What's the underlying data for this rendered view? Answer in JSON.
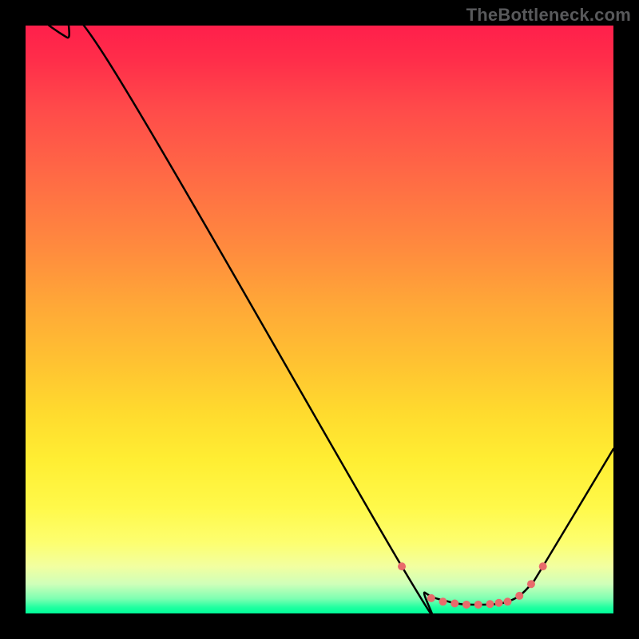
{
  "watermark": {
    "text": "TheBottleneck.com"
  },
  "chart_data": {
    "type": "line",
    "title": "",
    "xlabel": "",
    "ylabel": "",
    "xlim": [
      0,
      100
    ],
    "ylim": [
      0,
      100
    ],
    "grid": false,
    "series": [
      {
        "name": "curve",
        "x": [
          4,
          7,
          14,
          64,
          68,
          72,
          74,
          76,
          78,
          80,
          82,
          84,
          86,
          88,
          100
        ],
        "y": [
          100,
          98,
          94,
          8,
          3.5,
          2,
          1.6,
          1.5,
          1.5,
          1.6,
          2,
          3,
          5,
          8,
          28
        ]
      }
    ],
    "markers": {
      "name": "dots",
      "x": [
        64,
        69,
        71,
        73,
        75,
        77,
        79,
        80.5,
        82,
        84,
        86,
        88
      ],
      "y": [
        8,
        2.6,
        2.0,
        1.7,
        1.5,
        1.5,
        1.6,
        1.8,
        2.0,
        3.0,
        5.0,
        8.0
      ]
    },
    "gradient": {
      "top": "#ff1f4b",
      "mid": "#ffee33",
      "bottom": "#00ff99"
    }
  }
}
